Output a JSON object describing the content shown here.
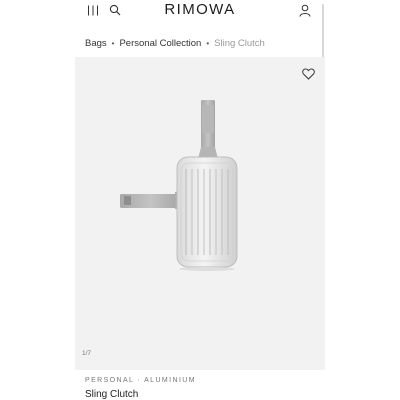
{
  "header": {
    "logo": "RIMOWA",
    "menu_icon": "menu-icon",
    "search_icon": "search-icon",
    "account_icon": "account-icon"
  },
  "breadcrumb": {
    "items": [
      "Bags",
      "Personal Collection",
      "Sling Clutch"
    ],
    "separator": "•"
  },
  "gallery": {
    "wishlist_icon": "heart-icon",
    "counter": "1/7",
    "image_description": "silver aluminium sling clutch"
  },
  "product": {
    "category": "PERSONAL · ALUMINIUM",
    "name": "Sling Clutch"
  },
  "colors": {
    "background": "#ffffff",
    "gallery_bg": "#f2f2f2",
    "breadcrumb_current": "#9a9a9a"
  }
}
